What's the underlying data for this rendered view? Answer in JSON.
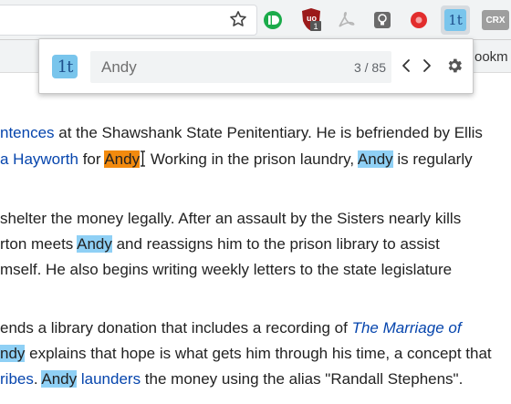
{
  "browser": {
    "bookmarks_label": "ookm",
    "extensions": [
      {
        "name": "pushbullet",
        "color": "#1bab4a"
      },
      {
        "name": "ublock",
        "color": "#9b1a1a",
        "badge": "1"
      },
      {
        "name": "pdf",
        "color": "#b7b7b7"
      },
      {
        "name": "lightbulb",
        "color": "#6a6a6a"
      },
      {
        "name": "record",
        "color": "#e22d2d"
      },
      {
        "name": "find-tool",
        "color": "#79c5ec",
        "label": "1t"
      },
      {
        "name": "crx",
        "color": "#9e9e9e",
        "label": "CRX"
      }
    ]
  },
  "find_popup": {
    "logo_text": "1t",
    "query": "Andy",
    "count": "3 / 85"
  },
  "article": {
    "line1": {
      "link1": "ntences",
      "text1": " at the Shawshank State Penitentiary. He is befriended by Ellis"
    },
    "line2": {
      "link1": "a Hayworth",
      "text1": " for ",
      "match_current": "Andy",
      "text2": " Working in the prison laundry, ",
      "match": "Andy",
      "text3": " is regularly"
    },
    "line3": {
      "text1": "shelter the money legally. After an assault by the Sisters nearly kills"
    },
    "line4": {
      "text1": "rton meets ",
      "match": "Andy",
      "text2": " and reassigns him to the prison library to assist"
    },
    "line5": {
      "text1": "mself. He also begins writing weekly letters to the state legislature"
    },
    "line6": {
      "text1": "ends a library donation that includes a recording of ",
      "link_italic": "The Marriage of"
    },
    "line7": {
      "match": "ndy",
      "text1": " explains that hope is what gets him through his time, a concept that"
    },
    "line8": {
      "link1": "ribes",
      "text1": ". ",
      "match": "Andy",
      "text2": " ",
      "link2": "launders",
      "text3": " the money using the alias \"Randall Stephens\"."
    }
  }
}
